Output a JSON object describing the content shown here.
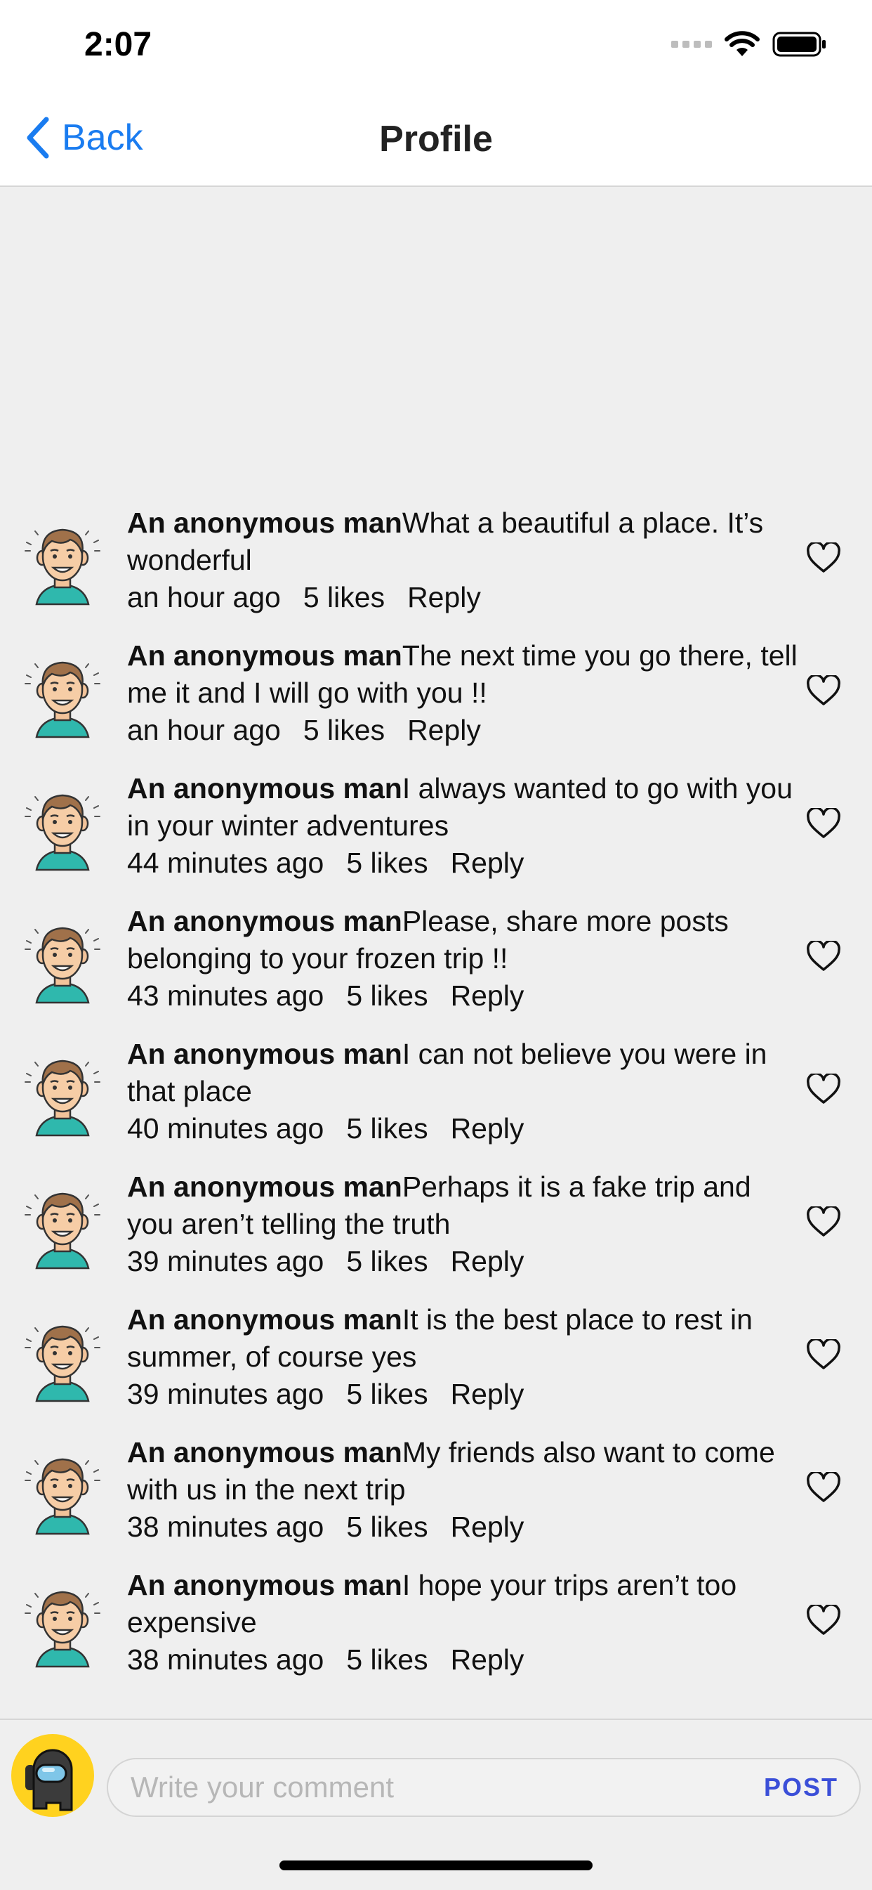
{
  "status_bar": {
    "time": "2:07"
  },
  "nav": {
    "back_label": "Back",
    "title": "Profile"
  },
  "comments": [
    {
      "author": "An anonymous man",
      "text": "What a beautiful a place. It’s wonderful",
      "time": "an hour ago",
      "likes": "5 likes",
      "reply": "Reply"
    },
    {
      "author": "An anonymous man",
      "text": "The next time you go there, tell me it and I will go with you !!",
      "time": "an hour ago",
      "likes": "5 likes",
      "reply": "Reply"
    },
    {
      "author": "An anonymous man",
      "text": "I always wanted to go with you in your winter adventures",
      "time": "44 minutes ago",
      "likes": "5 likes",
      "reply": "Reply"
    },
    {
      "author": "An anonymous man",
      "text": "Please, share more posts belonging to your frozen trip !!",
      "time": "43 minutes ago",
      "likes": "5 likes",
      "reply": "Reply"
    },
    {
      "author": "An anonymous man",
      "text": "I can not believe you were in that place",
      "time": "40 minutes ago",
      "likes": "5 likes",
      "reply": "Reply"
    },
    {
      "author": "An anonymous man",
      "text": "Perhaps it is a fake trip and you aren’t telling the truth",
      "time": "39 minutes ago",
      "likes": "5 likes",
      "reply": "Reply"
    },
    {
      "author": "An anonymous man",
      "text": "It is the best place to rest in summer, of course yes",
      "time": "39 minutes ago",
      "likes": "5 likes",
      "reply": "Reply"
    },
    {
      "author": "An anonymous man",
      "text": "My friends also want to come with us in the next trip",
      "time": "38 minutes ago",
      "likes": "5 likes",
      "reply": "Reply"
    },
    {
      "author": "An anonymous man",
      "text": "I hope your trips aren’t too expensive",
      "time": "38 minutes ago",
      "likes": "5 likes",
      "reply": "Reply"
    }
  ],
  "composer": {
    "placeholder": "Write your comment",
    "post_label": "POST"
  },
  "colors": {
    "accent": "#1a7cf0",
    "post": "#3b4fd8",
    "background": "#efefef",
    "user_avatar_bg": "#ffd21f"
  }
}
